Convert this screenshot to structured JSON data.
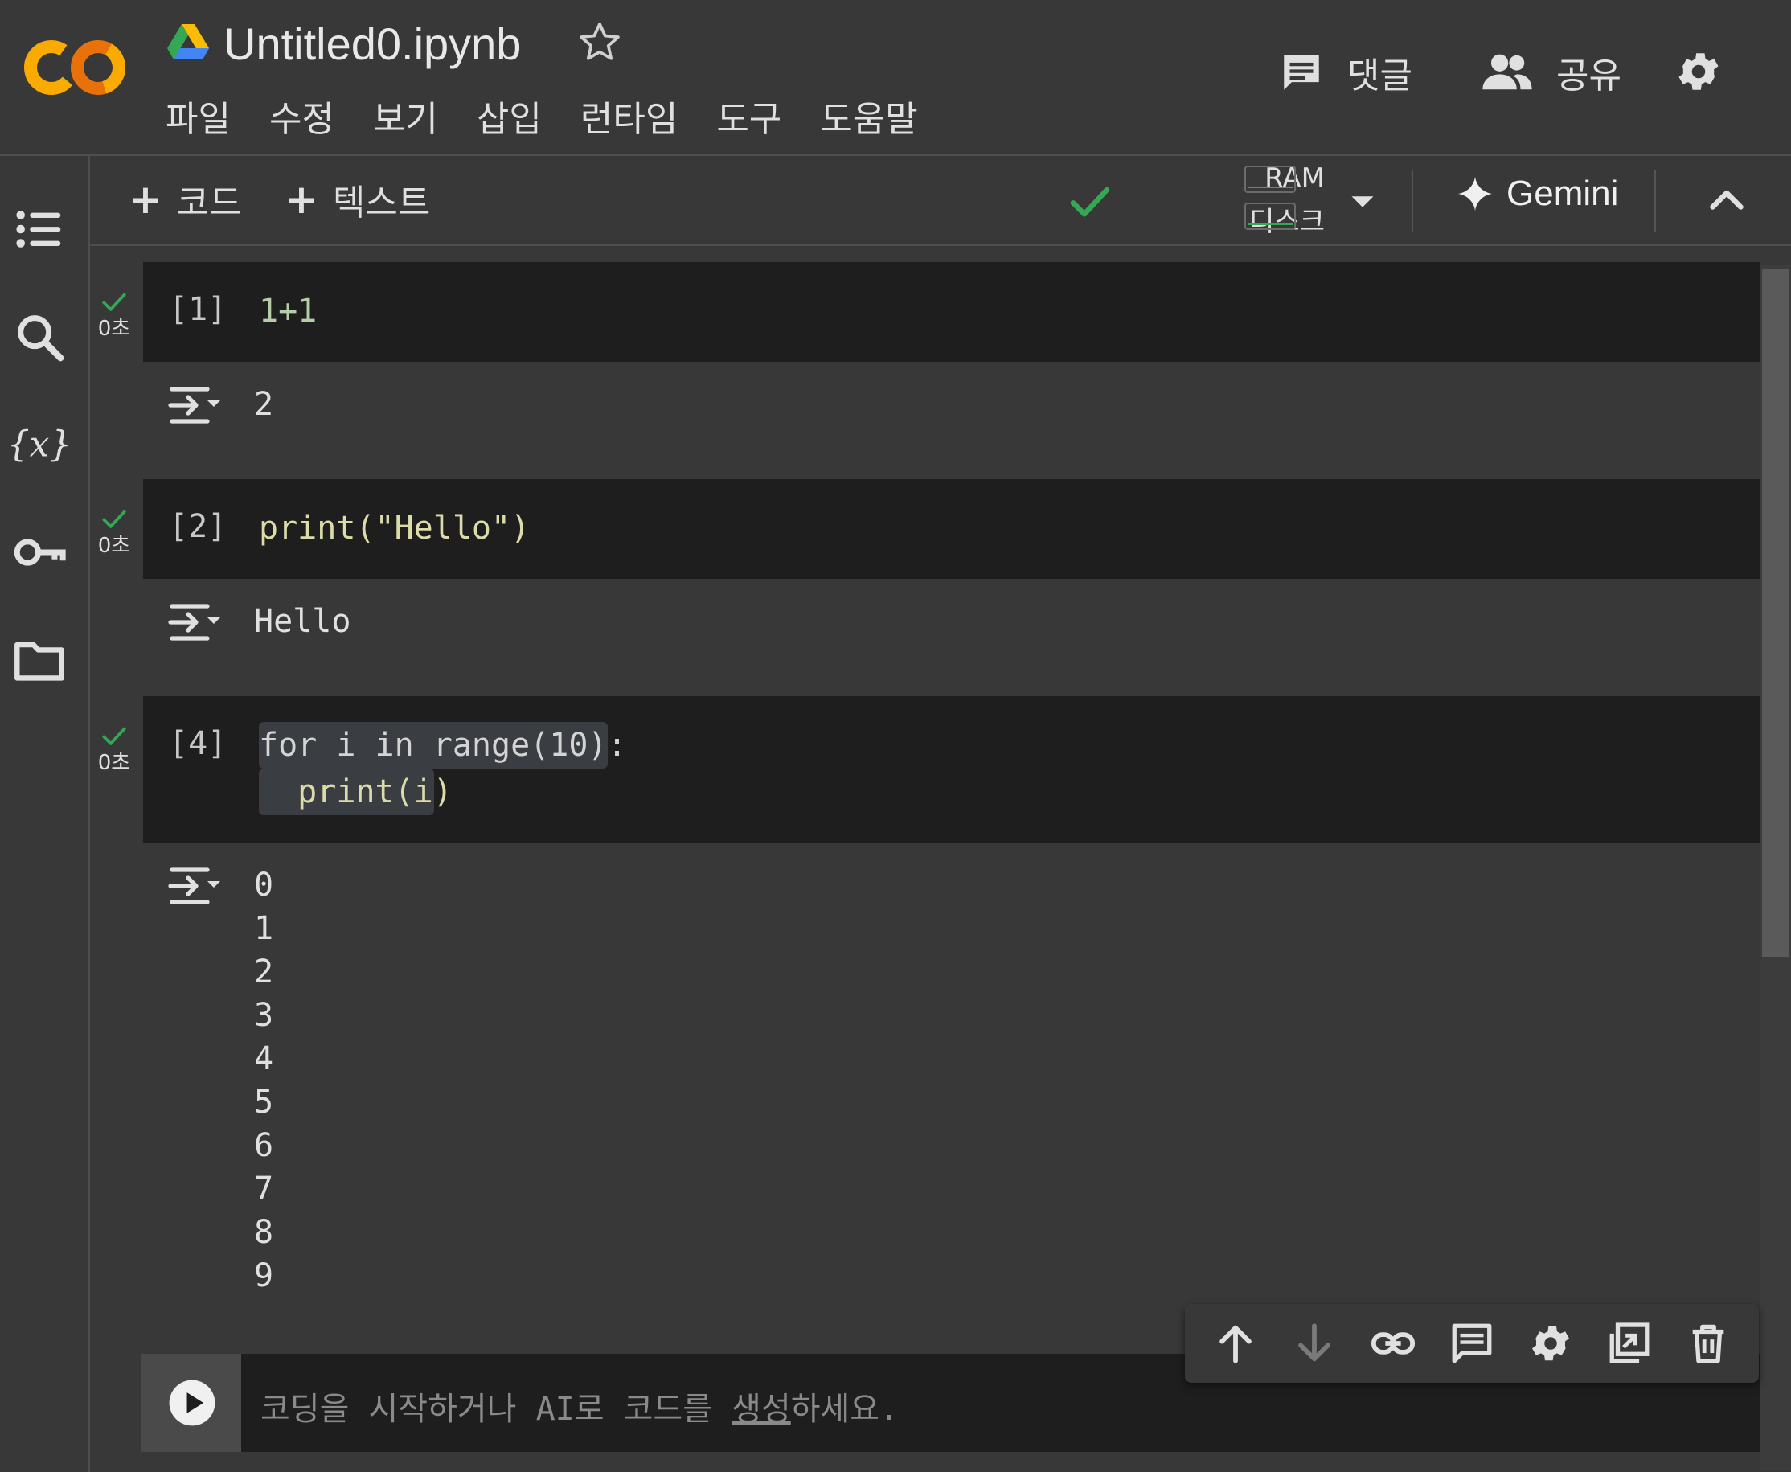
{
  "header": {
    "title": "Untitled0.ipynb",
    "logo_text": "CO",
    "menu": [
      "파일",
      "수정",
      "보기",
      "삽입",
      "런타임",
      "도구",
      "도움말"
    ],
    "comment_label": "댓글",
    "share_label": "공유"
  },
  "toolbar": {
    "add_code": "코드",
    "add_text": "텍스트",
    "ram_label": "RAM",
    "disk_label": "디스크",
    "gemini_label": "Gemini"
  },
  "cells": [
    {
      "count": "[1]",
      "time": "0초",
      "code": [
        "1+1"
      ],
      "output": [
        "2"
      ]
    },
    {
      "count": "[2]",
      "time": "0초",
      "code": [
        "print(\"Hello\")"
      ],
      "output": [
        "Hello"
      ]
    },
    {
      "count": "[4]",
      "time": "0초",
      "code": [
        "for i in range(10):",
        "  print(i)"
      ],
      "output": [
        "0",
        "1",
        "2",
        "3",
        "4",
        "5",
        "6",
        "7",
        "8",
        "9"
      ]
    }
  ],
  "empty_cell": {
    "placeholder_pre": "코딩을 시작하거나 AI로 코드를 ",
    "placeholder_link": "생성",
    "placeholder_post": "하세요."
  },
  "colors": {
    "background": "#383838",
    "code_bg": "#1e1e1e",
    "success": "#34a853",
    "logo_orange": "#f9ab00",
    "logo_dark_orange": "#e8710a"
  },
  "icons": [
    "table-of-contents-icon",
    "search-icon",
    "variables-icon",
    "key-icon",
    "folder-icon",
    "comment-icon",
    "people-icon",
    "gear-icon",
    "star-icon",
    "check-icon",
    "chevron-up-icon",
    "sparkle-icon",
    "run-icon",
    "arrow-up-icon",
    "arrow-down-icon",
    "link-icon",
    "comment-icon",
    "mirror-cell-icon",
    "delete-icon"
  ]
}
